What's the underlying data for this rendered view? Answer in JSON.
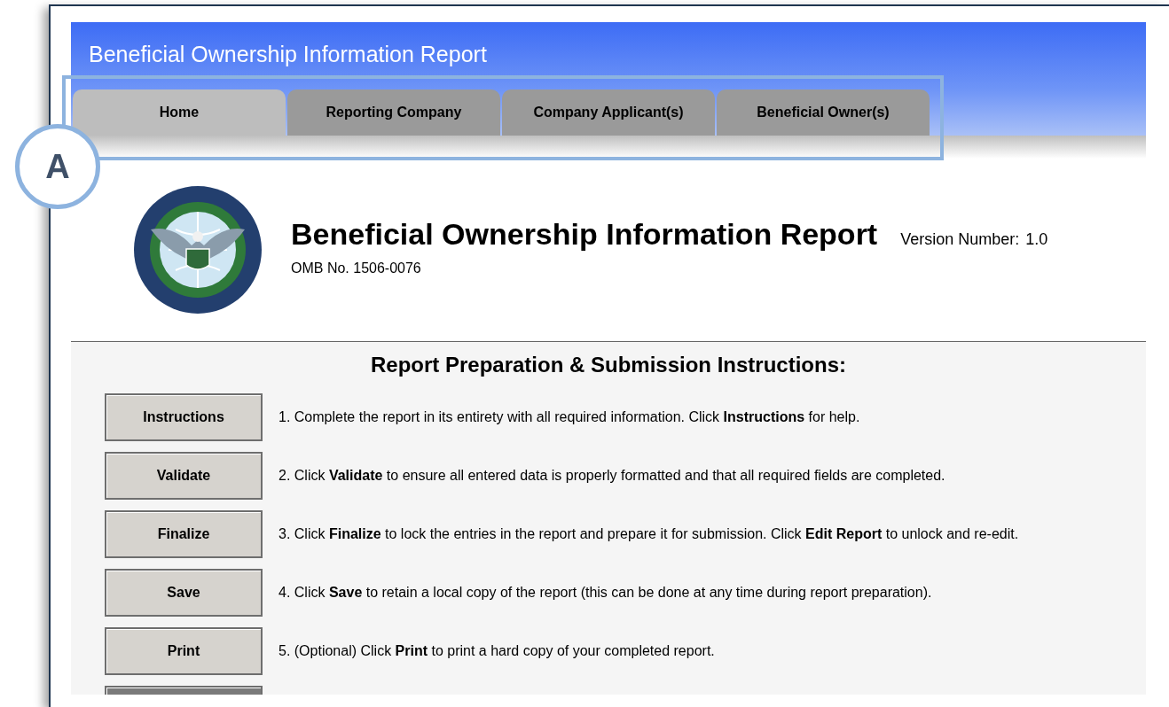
{
  "header": {
    "title": "Beneficial Ownership Information Report"
  },
  "tabs": [
    {
      "label": "Home",
      "selected": true
    },
    {
      "label": "Reporting Company",
      "selected": false
    },
    {
      "label": "Company Applicant(s)",
      "selected": false
    },
    {
      "label": "Beneficial Owner(s)",
      "selected": false
    }
  ],
  "callout": {
    "label": "A"
  },
  "report": {
    "title": "Beneficial Ownership Information Report",
    "version_label": "Version Number:",
    "version": "1.0",
    "omb": "OMB No. 1506-0076"
  },
  "instructions": {
    "heading": "Report Preparation & Submission Instructions:",
    "steps": [
      {
        "button": "Instructions",
        "text": "1. Complete the report in its entirety with all required information. Click **Instructions** for help."
      },
      {
        "button": "Validate",
        "text": "2. Click **Validate** to ensure all entered data is properly formatted and that all required fields are completed."
      },
      {
        "button": "Finalize",
        "text": "3. Click **Finalize** to lock the entries in the report and prepare it for submission. Click **Edit Report** to unlock and re-edit."
      },
      {
        "button": "Save",
        "text": "4. Click **Save** to retain a local copy of the report (this can be done at any time during report preparation)."
      },
      {
        "button": "Print",
        "text": "5. (Optional) Click **Print** to print a hard copy of your completed report."
      }
    ]
  }
}
